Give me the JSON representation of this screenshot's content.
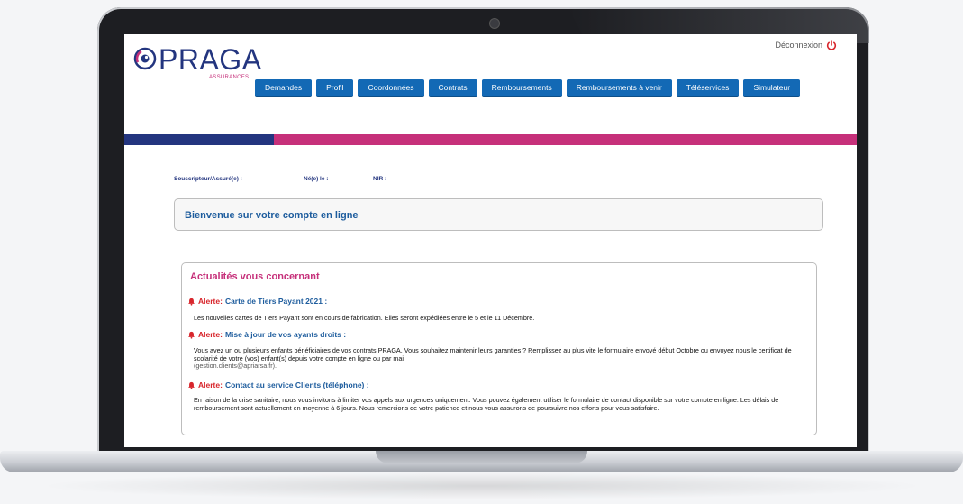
{
  "brand": {
    "name": "PRAGA",
    "tagline": "ASSURANCES"
  },
  "header": {
    "logout_label": "Déconnexion"
  },
  "nav": [
    "Demandes",
    "Profil",
    "Coordonnées",
    "Contrats",
    "Remboursements",
    "Remboursements à venir",
    "Téléservices",
    "Simulateur"
  ],
  "colors": {
    "navy": "#23357f",
    "pink": "#c6307a",
    "button": "#1369b5",
    "alert": "#d8262c"
  },
  "info": {
    "subscriber_label": "Souscripteur/Assuré(e) :",
    "birth_label": "Né(e) le :",
    "nir_label": "NIR :"
  },
  "welcome": {
    "text": "Bienvenue sur votre compte en ligne"
  },
  "news": {
    "title": "Actualités vous concernant",
    "alerts": [
      {
        "prefix": "Alerte:",
        "title": "Carte de Tiers Payant 2021 :",
        "body": "Les nouvelles cartes de Tiers Payant sont en cours de fabrication. Elles seront expédiées entre le 5 et le 11 Décembre."
      },
      {
        "prefix": "Alerte:",
        "title": "Mise à jour de vos ayants droits :",
        "body": "Vous avez un ou plusieurs enfants bénéficiaires de vos contrats PRAGA. Vous souhaitez maintenir leurs garanties ? Remplissez au plus vite le formulaire envoyé début Octobre ou envoyez nous le certificat de scolarité de votre (vos) enfant(s) depuis votre compte en ligne ou par mail",
        "email": "(gestion.clients@apriarsa.fr)."
      },
      {
        "prefix": "Alerte:",
        "title": "Contact au service Clients (téléphone) :",
        "body": "En raison de la crise sanitaire, nous vous invitons à limiter vos appels aux urgences uniquement. Vous pouvez également utiliser le formulaire de contact disponible sur votre compte en ligne. Les délais de remboursement sont actuellement en moyenne à 6 jours. Nous remercions de votre patience et nous vous assurons de poursuivre nos efforts pour vous satisfaire."
      }
    ]
  }
}
